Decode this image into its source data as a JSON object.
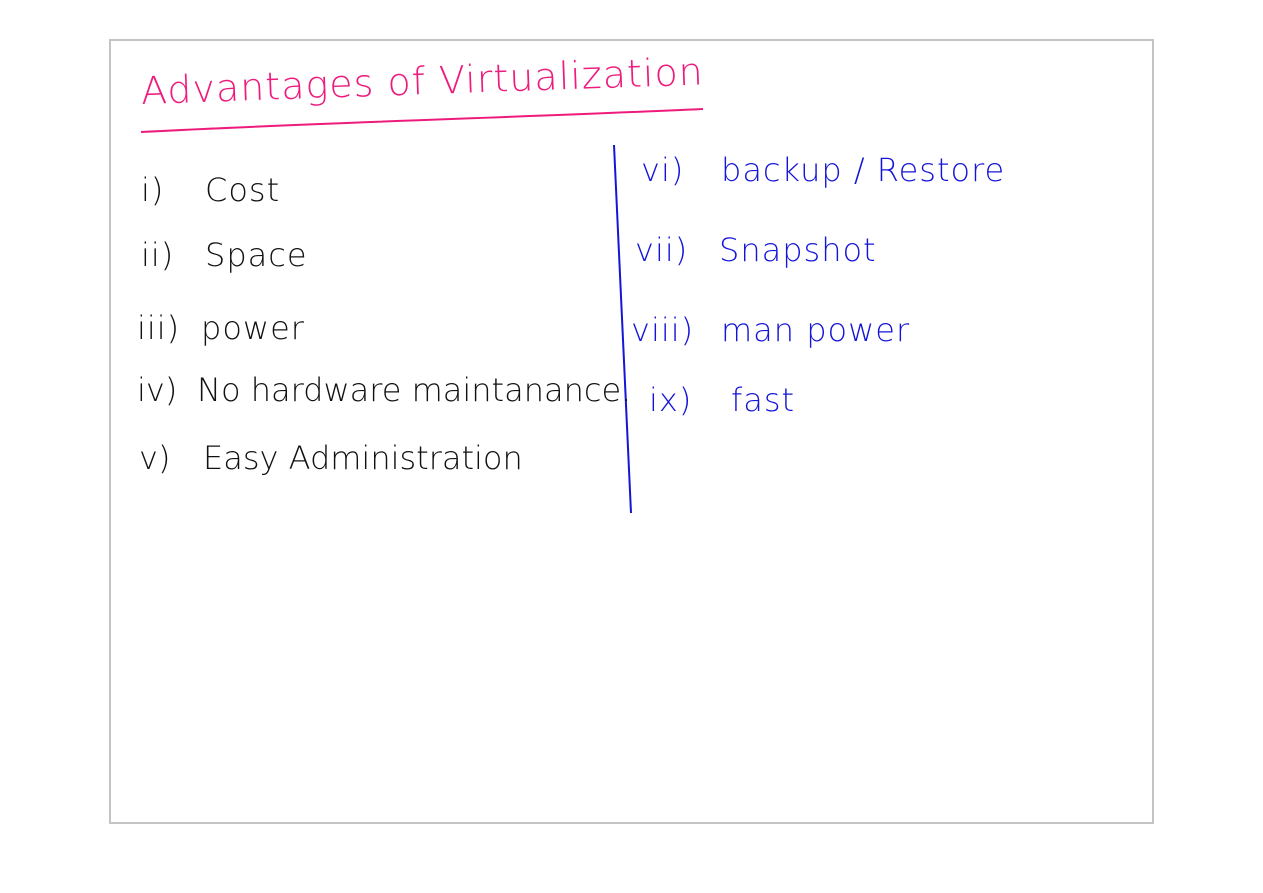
{
  "title": "Advantages of Virtualization",
  "left_items": [
    {
      "num": "i)",
      "label": "Cost"
    },
    {
      "num": "ii)",
      "label": "Space"
    },
    {
      "num": "iii)",
      "label": "power"
    },
    {
      "num": "iv)",
      "label": "No hardware maintanance."
    },
    {
      "num": "v)",
      "label": "Easy Administration"
    }
  ],
  "right_items": [
    {
      "num": "vi)",
      "label": "backup / Restore"
    },
    {
      "num": "vii)",
      "label": "Snapshot"
    },
    {
      "num": "viii)",
      "label": "man power"
    },
    {
      "num": "ix)",
      "label": "fast"
    }
  ],
  "colors": {
    "title": "#ee1b7d",
    "left_ink": "#111111",
    "right_ink": "#1515d8",
    "border": "#c4c4c4"
  }
}
